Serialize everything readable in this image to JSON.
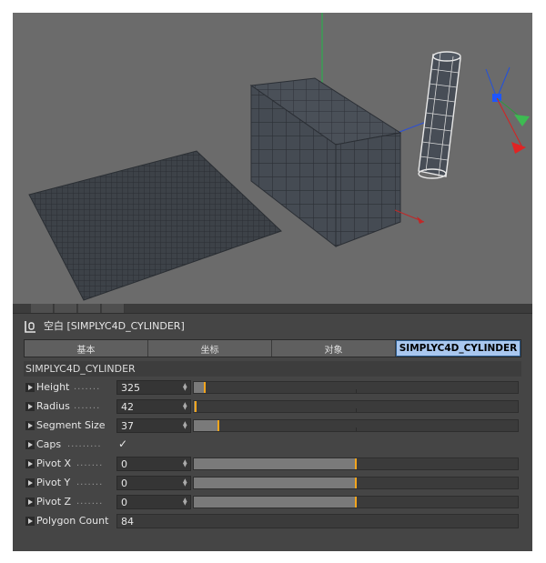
{
  "object_title": "空白 [SIMPLYC4D_CYLINDER]",
  "tabs": [
    {
      "label": "基本",
      "active": false
    },
    {
      "label": "坐标",
      "active": false
    },
    {
      "label": "对象",
      "active": false
    },
    {
      "label": "SIMPLYC4D_CYLINDER",
      "active": true
    }
  ],
  "section_title": "SIMPLYC4D_CYLINDER",
  "params": {
    "height": {
      "label": "Height",
      "dots": ".......",
      "value": "325",
      "slider": 0.035
    },
    "radius": {
      "label": "Radius",
      "dots": ".......",
      "value": "42",
      "slider": 0.005
    },
    "segment_size": {
      "label": "Segment Size",
      "dots": "",
      "value": "37",
      "slider": 0.075
    },
    "caps": {
      "label": "Caps",
      "dots": ".........",
      "checked": "✓"
    },
    "pivot_x": {
      "label": "Pivot X",
      "dots": ".......",
      "value": "0",
      "slider": 0.5
    },
    "pivot_y": {
      "label": "Pivot Y",
      "dots": ".......",
      "value": "0",
      "slider": 0.5
    },
    "pivot_z": {
      "label": "Pivot Z",
      "dots": ".......",
      "value": "0",
      "slider": 0.5
    },
    "polygon_count": {
      "label": "Polygon Count",
      "value": "84"
    }
  },
  "colors": {
    "viewport_bg": "#6b6b6b",
    "panel_bg": "#454545",
    "active_tab": "#a9c7ef",
    "slider_handle": "#f3a51d",
    "axis_x": "#e02020",
    "axis_y": "#20c040",
    "axis_z": "#2050e0"
  },
  "icons": {
    "object_icon": "null-object-icon",
    "row_toggle": "triangle-right-icon"
  }
}
